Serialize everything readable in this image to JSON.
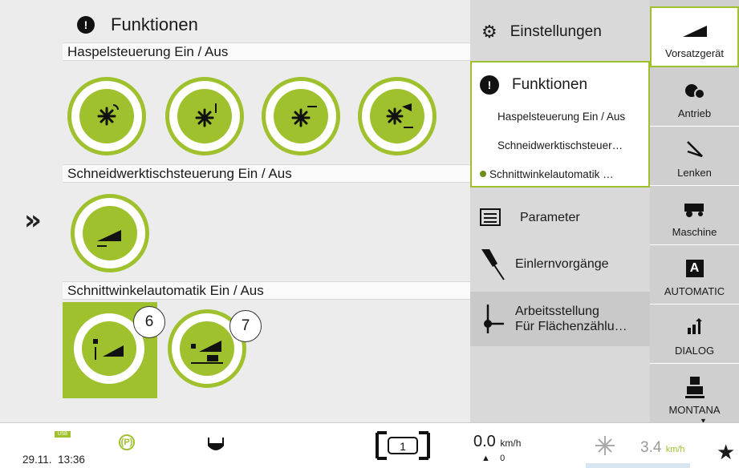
{
  "expand": {
    "icon": "»"
  },
  "main": {
    "title": "Funktionen",
    "sections": [
      {
        "label": "Haspelsteuerung Ein / Aus"
      },
      {
        "label": "Schneidwerktischsteuerung Ein / Aus"
      },
      {
        "label": "Schnittwinkelautomatik Ein / Aus"
      }
    ],
    "badges": [
      "6",
      "7"
    ]
  },
  "menu": {
    "einstellungen": "Einstellungen",
    "funktionen": "Funktionen",
    "sub_items": [
      "Haspelsteuerung Ein / Aus",
      "Schneidwerktischsteuer…",
      "Schnittwinkelautomatik …"
    ],
    "parameter": "Parameter",
    "einlern": "Einlernvorgänge",
    "arbeits_line1": "Arbeitsstellung",
    "arbeits_line2": "Für Flächenzählu…"
  },
  "tabs": [
    "Vorsatzgerät",
    "Antrieb",
    "Lenken",
    "Maschine",
    "AUTOMATIC",
    "DIALOG",
    "MONTANA"
  ],
  "tab_icons": [
    "header-icon",
    "drive-icon",
    "steering-icon",
    "combine-icon",
    "automatic-icon",
    "cemos-icon",
    "montana-icon"
  ],
  "status": {
    "usb": "USB",
    "date": "29.11.",
    "time": "13:36",
    "parking": "(P)",
    "gear_marker": "1",
    "speed": "0.0",
    "speed_unit": "km/h",
    "gear": "0",
    "target_speed": "3.4",
    "target_unit": "km/h"
  },
  "colors": {
    "accent": "#9fc12d",
    "panel": "#ececec",
    "menu": "#d9d9d9"
  }
}
